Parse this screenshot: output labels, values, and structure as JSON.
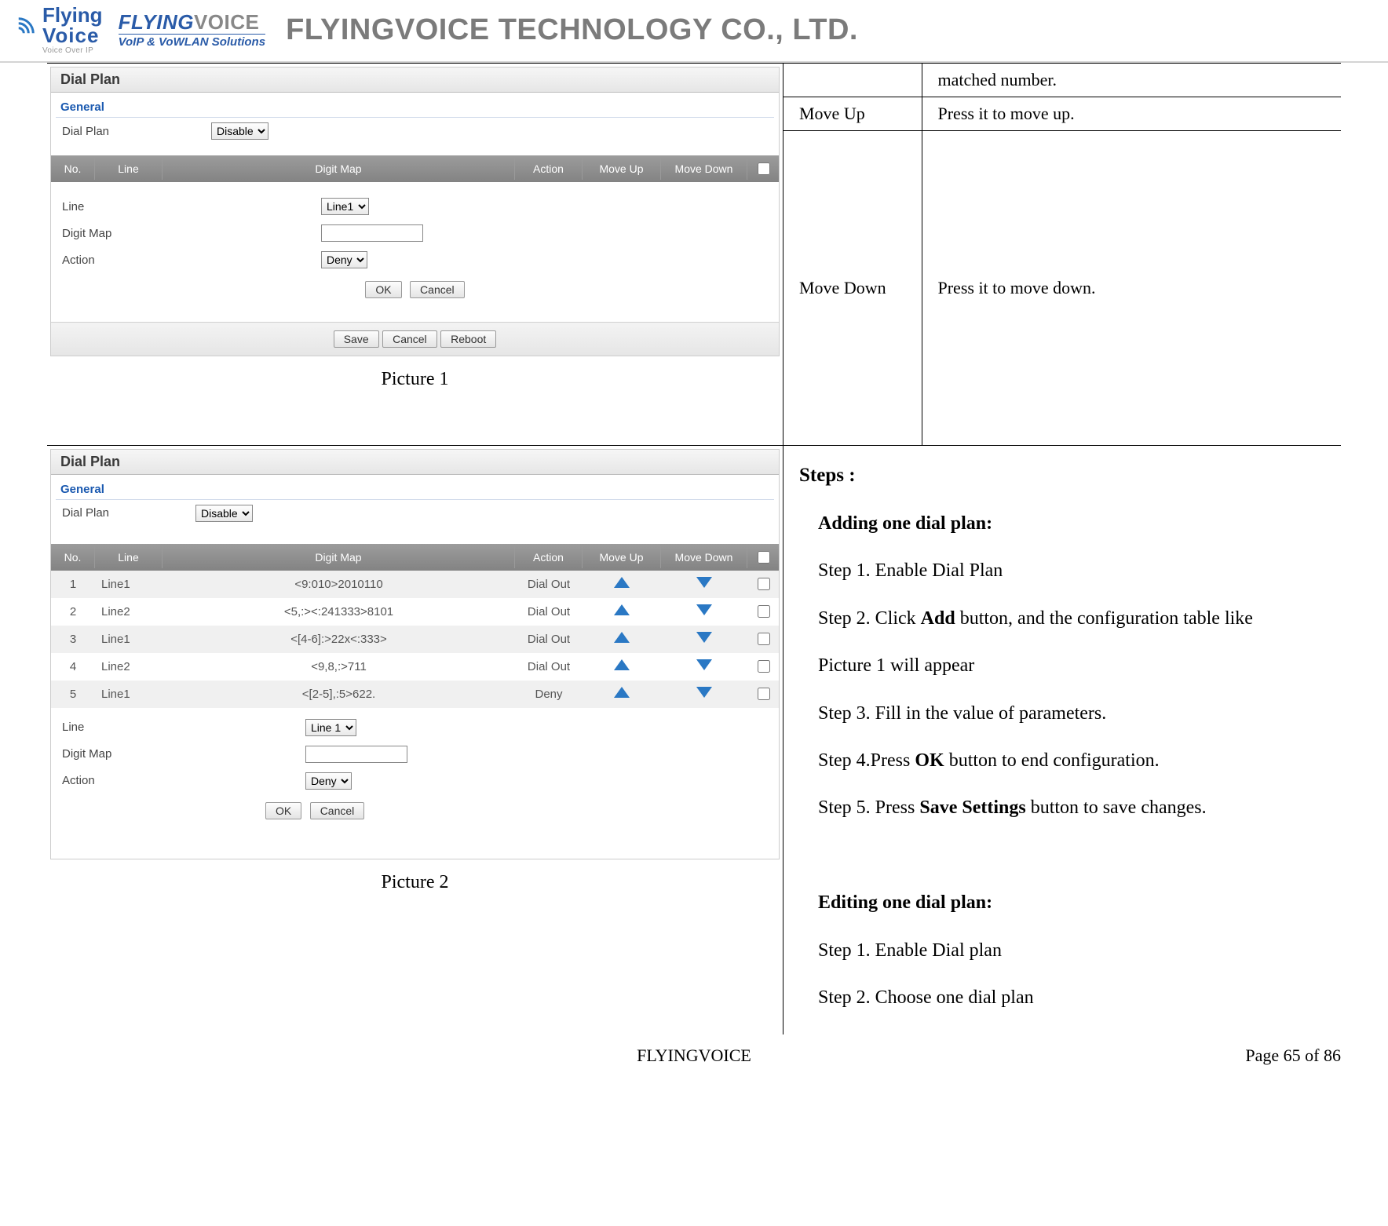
{
  "header": {
    "logo1_line1": "Flying",
    "logo1_line2": "Voice",
    "logo1_sub": "Voice Over IP",
    "logo2_brand_blue": "FLYING",
    "logo2_brand_grey": "VOICE",
    "logo2_sub": "VoIP & VoWLAN Solutions",
    "company": "FLYINGVOICE TECHNOLOGY CO., LTD."
  },
  "table1": {
    "r0_col2": "matched number.",
    "r1_col1": "Move Up",
    "r1_col2": "Press it to move up.",
    "r2_col1": "Move Down",
    "r2_col2": "Press it to move down."
  },
  "caption1": "Picture 1",
  "caption2": "Picture 2",
  "screenshot": {
    "title": "Dial Plan",
    "section": "General",
    "dialplan_label": "Dial Plan",
    "dialplan_value": "Disable",
    "headers": {
      "no": "No.",
      "line": "Line",
      "map": "Digit Map",
      "action": "Action",
      "up": "Move Up",
      "down": "Move Down"
    },
    "line_label": "Line",
    "line_value": "Line1",
    "line2_value": "Line 1",
    "digitmap_label": "Digit Map",
    "action_label": "Action",
    "action_value": "Deny",
    "btn_ok": "OK",
    "btn_cancel": "Cancel",
    "btn_save": "Save",
    "btn_cancel2": "Cancel",
    "btn_reboot": "Reboot"
  },
  "rows": [
    {
      "no": "1",
      "line": "Line1",
      "map": "<9:010>2010110",
      "action": "Dial Out"
    },
    {
      "no": "2",
      "line": "Line2",
      "map": "<5,:><:241333>8101",
      "action": "Dial Out"
    },
    {
      "no": "3",
      "line": "Line1",
      "map": "<[4-6]:>22x<:333>",
      "action": "Dial Out"
    },
    {
      "no": "4",
      "line": "Line2",
      "map": "<9,8,:>711",
      "action": "Dial Out"
    },
    {
      "no": "5",
      "line": "Line1",
      "map": "<[2-5],:5>622.",
      "action": "Deny"
    }
  ],
  "steps": {
    "title": "Steps :",
    "add_title": "Adding one dial plan:",
    "s1": "Step 1. Enable Dial Plan",
    "s2a": "Step 2. Click ",
    "s2b": "Add",
    "s2c": " button, and the configuration table like",
    "s2cont": "Picture 1 will appear",
    "s3": "Step 3. Fill in the value of parameters.",
    "s4a": "Step 4.Press ",
    "s4b": "OK",
    "s4c": " button to end configuration.",
    "s5a": "Step 5. Press ",
    "s5b": "Save Settings",
    "s5c": " button to save changes.",
    "edit_title": "Editing one dial plan:",
    "e1": "Step 1. Enable Dial plan",
    "e2": "Step 2. Choose one dial plan"
  },
  "footer": {
    "center": "FLYINGVOICE",
    "right": "Page  65  of  86"
  }
}
